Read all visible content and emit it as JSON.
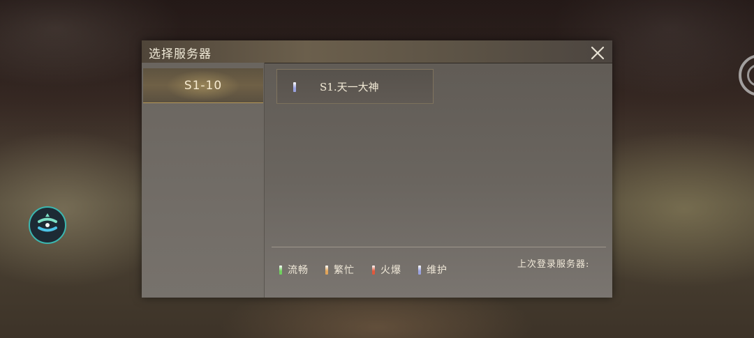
{
  "dialog": {
    "title": "选择服务器",
    "close_icon": "close-x-icon"
  },
  "sidebar": {
    "ranges": [
      {
        "label": "S1-10",
        "selected": true
      }
    ]
  },
  "servers": [
    {
      "name": "S1.天一大神",
      "status": "maintenance",
      "status_color": "#9aa2e0"
    }
  ],
  "legend": [
    {
      "label": "流畅",
      "color": "#6fcf5e"
    },
    {
      "label": "繁忙",
      "color": "#e0a45a"
    },
    {
      "label": "火爆",
      "color": "#e0583c"
    },
    {
      "label": "维护",
      "color": "#9aa2e0"
    }
  ],
  "last_login": {
    "label": "上次登录服务器:"
  },
  "overlay": {
    "logo_icon": "guopan-logo-icon",
    "side_icon": "ring-button-icon"
  }
}
